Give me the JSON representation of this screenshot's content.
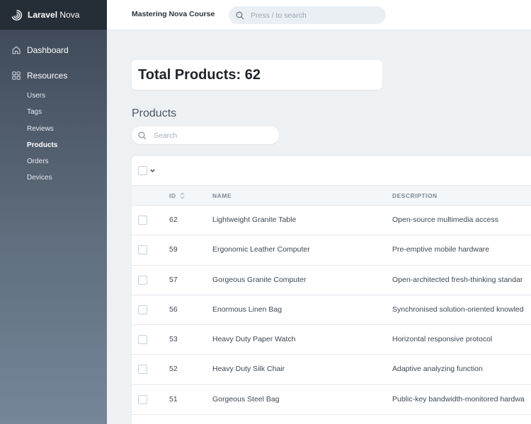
{
  "brand": {
    "name_bold": "Laravel",
    "name_rest": " Nova"
  },
  "sidebar": {
    "dashboard_label": "Dashboard",
    "resources_label": "Resources",
    "items": [
      {
        "label": "Users"
      },
      {
        "label": "Tags"
      },
      {
        "label": "Reviews"
      },
      {
        "label": "Products"
      },
      {
        "label": "Orders"
      },
      {
        "label": "Devices"
      }
    ],
    "active_item": "Products"
  },
  "header": {
    "app_title": "Mastering Nova Course",
    "search_placeholder": "Press / to search"
  },
  "metric": {
    "text": "Total Products: 62"
  },
  "resource": {
    "title": "Products",
    "search_placeholder": "Search"
  },
  "table": {
    "columns": {
      "id": "ID",
      "name": "NAME",
      "description": "DESCRIPTION"
    },
    "rows": [
      {
        "id": "62",
        "name": "Lightweight Granite Table",
        "description": "Open-source multimedia access"
      },
      {
        "id": "59",
        "name": "Ergonomic Leather Computer",
        "description": "Pre-emptive mobile hardware"
      },
      {
        "id": "57",
        "name": "Gorgeous Granite Computer",
        "description": "Open-architected fresh-thinking standar"
      },
      {
        "id": "56",
        "name": "Enormous Linen Bag",
        "description": "Synchronised solution-oriented knowled"
      },
      {
        "id": "53",
        "name": "Heavy Duty Paper Watch",
        "description": "Horizontal responsive protocol"
      },
      {
        "id": "52",
        "name": "Heavy Duty Silk Chair",
        "description": "Adaptive analyzing function"
      },
      {
        "id": "51",
        "name": "Gorgeous Steel Bag",
        "description": "Public-key bandwidth-monitored hardwa"
      }
    ]
  },
  "colors": {
    "sidebar_top": "#3c4655",
    "sidebar_bottom": "#768699",
    "brand_bar": "#252d37",
    "page_bg": "#eef1f4"
  }
}
